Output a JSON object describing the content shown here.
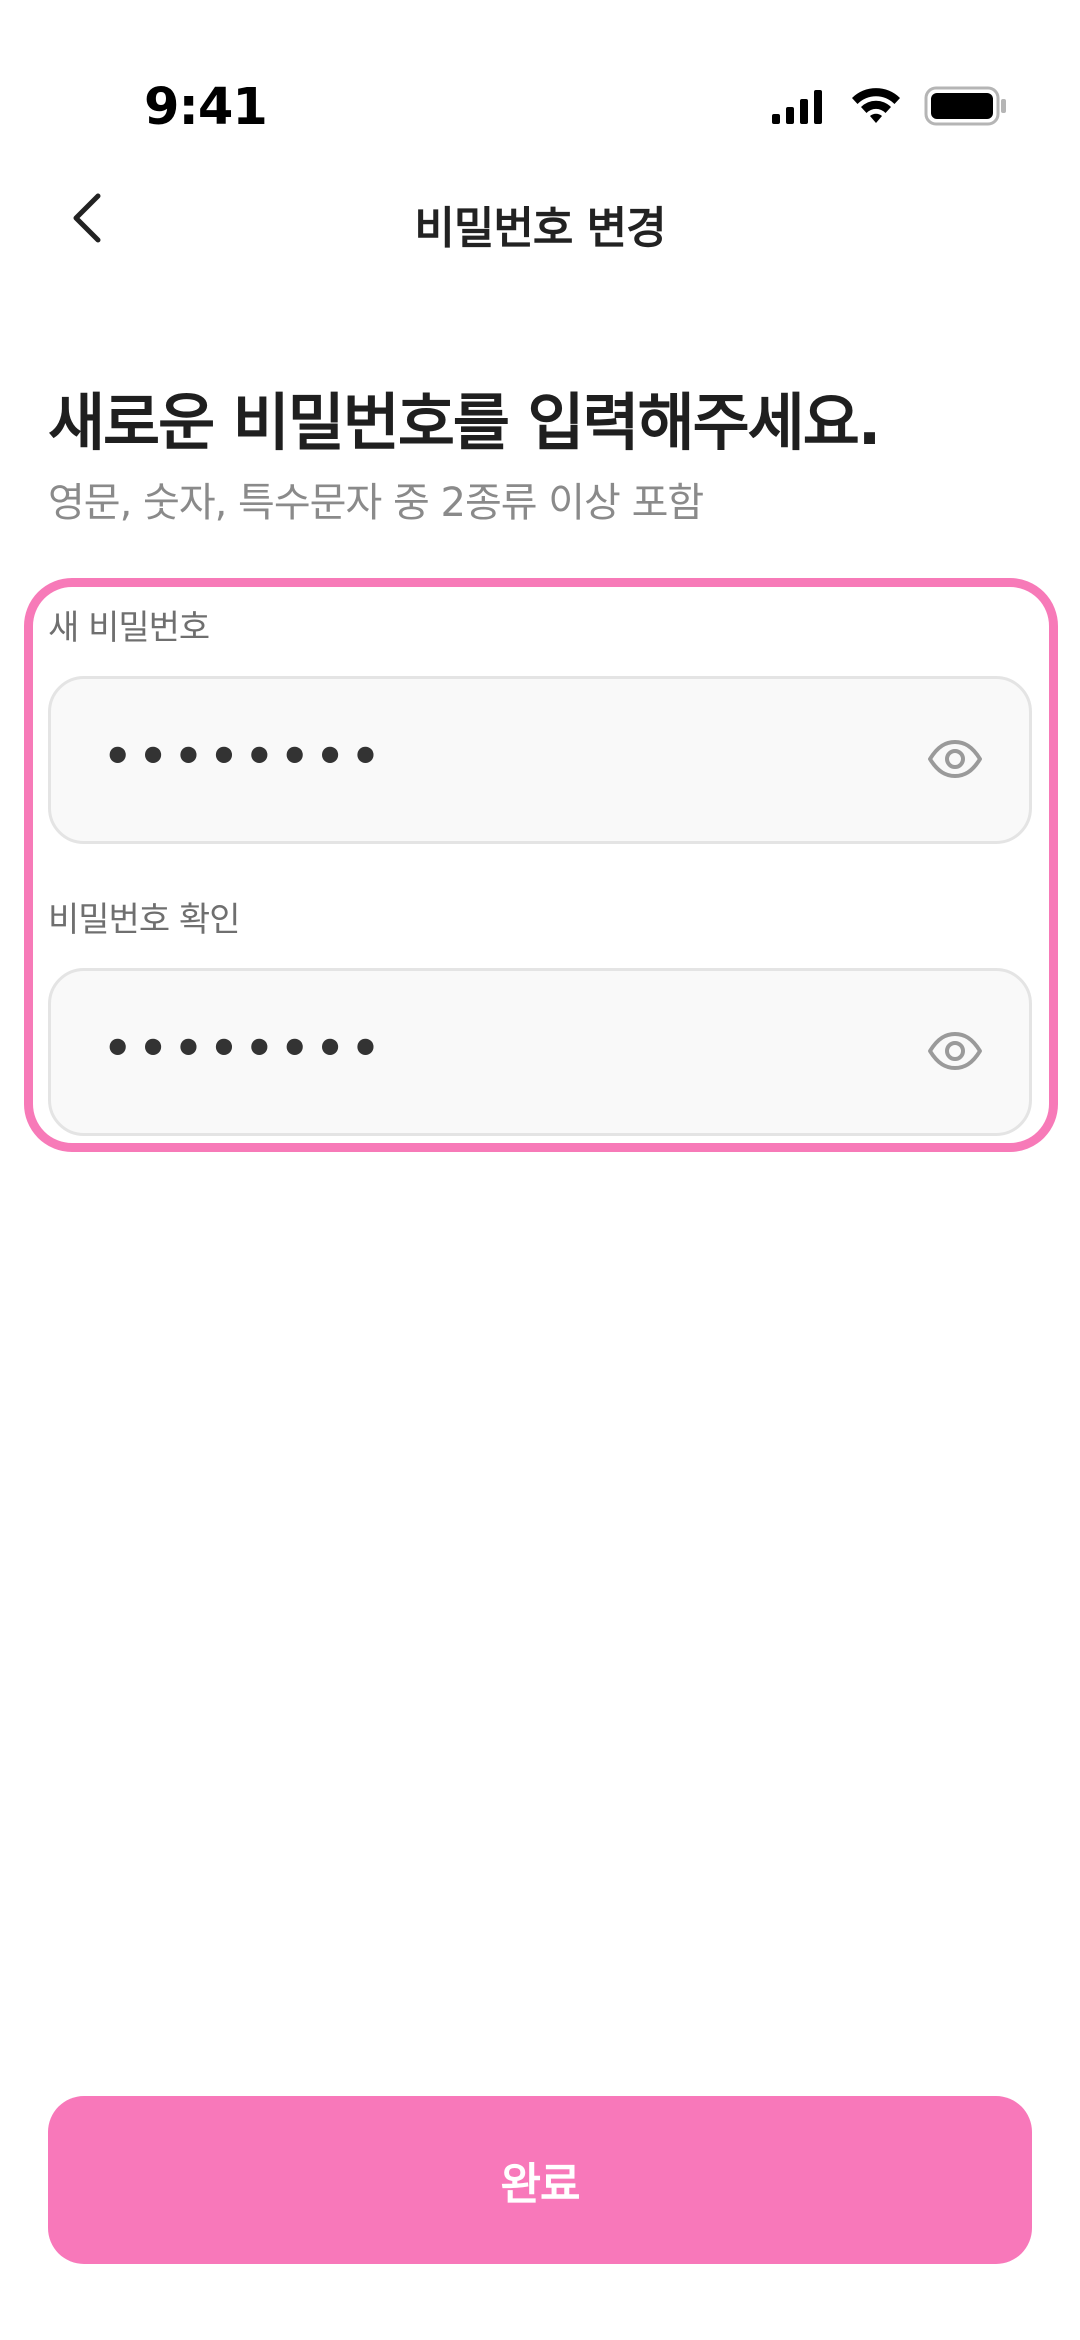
{
  "status_bar": {
    "time": "9:41"
  },
  "header": {
    "title": "비밀번호 변경"
  },
  "content": {
    "heading": "새로운 비밀번호를 입력해주세요.",
    "subheading": "영문, 숫자, 특수문자 중 2종류 이상 포함"
  },
  "form": {
    "new_password": {
      "label": "새 비밀번호",
      "value": "••••••••"
    },
    "confirm_password": {
      "label": "비밀번호 확인",
      "value": "••••••••"
    }
  },
  "submit": {
    "label": "완료"
  },
  "colors": {
    "accent": "#f878ba",
    "highlight_border": "#f77ab8",
    "input_bg": "#f9f9f9",
    "input_border": "#e4e4e4"
  },
  "icons": {
    "back": "chevron-left-icon",
    "visibility": "eye-icon",
    "signal": "signal-icon",
    "wifi": "wifi-icon",
    "battery": "battery-icon"
  }
}
